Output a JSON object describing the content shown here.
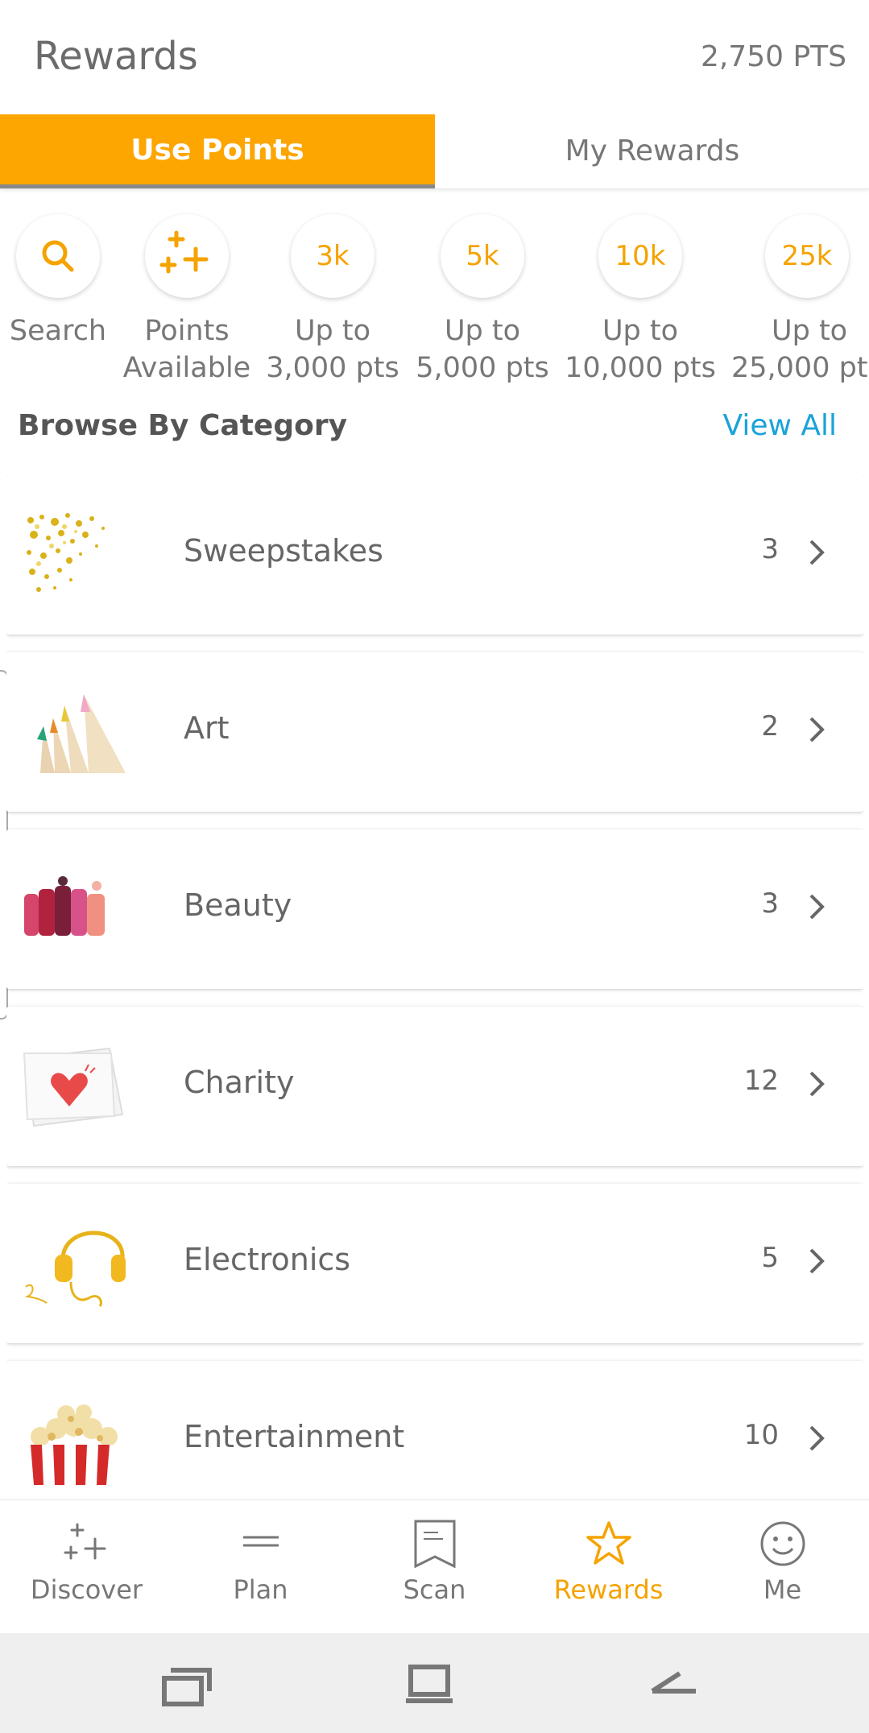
{
  "header": {
    "title": "Rewards",
    "points": "2,750 PTS"
  },
  "tabs": [
    {
      "label": "Use Points",
      "active": true
    },
    {
      "label": "My Rewards",
      "active": false
    }
  ],
  "filters": [
    {
      "circle": "",
      "icon": "search-icon",
      "line1": "Search",
      "line2": ""
    },
    {
      "circle": "",
      "icon": "sparkle-plus-icon",
      "line1": "Points",
      "line2": "Available"
    },
    {
      "circle": "3k",
      "line1": "Up to",
      "line2": "3,000 pts"
    },
    {
      "circle": "5k",
      "line1": "Up to",
      "line2": "5,000 pts"
    },
    {
      "circle": "10k",
      "line1": "Up to",
      "line2": "10,000 pts"
    },
    {
      "circle": "25k",
      "line1": "Up to",
      "line2": "25,000 pt"
    }
  ],
  "browse": {
    "title": "Browse By Category",
    "view_all": "View All"
  },
  "categories": [
    {
      "name": "Sweepstakes",
      "count": "3",
      "thumb": "confetti-image"
    },
    {
      "name": "Art",
      "count": "2",
      "thumb": "colored-pencils-image"
    },
    {
      "name": "Beauty",
      "count": "3",
      "thumb": "lipsticks-image"
    },
    {
      "name": "Charity",
      "count": "12",
      "thumb": "heart-card-image"
    },
    {
      "name": "Electronics",
      "count": "5",
      "thumb": "headphones-image"
    },
    {
      "name": "Entertainment",
      "count": "10",
      "thumb": "popcorn-image"
    }
  ],
  "nav": [
    {
      "label": "Discover",
      "icon": "sparkle-plus-icon",
      "active": false
    },
    {
      "label": "Plan",
      "icon": "list-lines-icon",
      "active": false
    },
    {
      "label": "Scan",
      "icon": "receipt-icon",
      "active": false
    },
    {
      "label": "Rewards",
      "icon": "star-icon",
      "active": true
    },
    {
      "label": "Me",
      "icon": "smiley-icon",
      "active": false
    }
  ],
  "colors": {
    "accent": "#fda500",
    "link": "#1aa3d9",
    "text": "#666666"
  }
}
